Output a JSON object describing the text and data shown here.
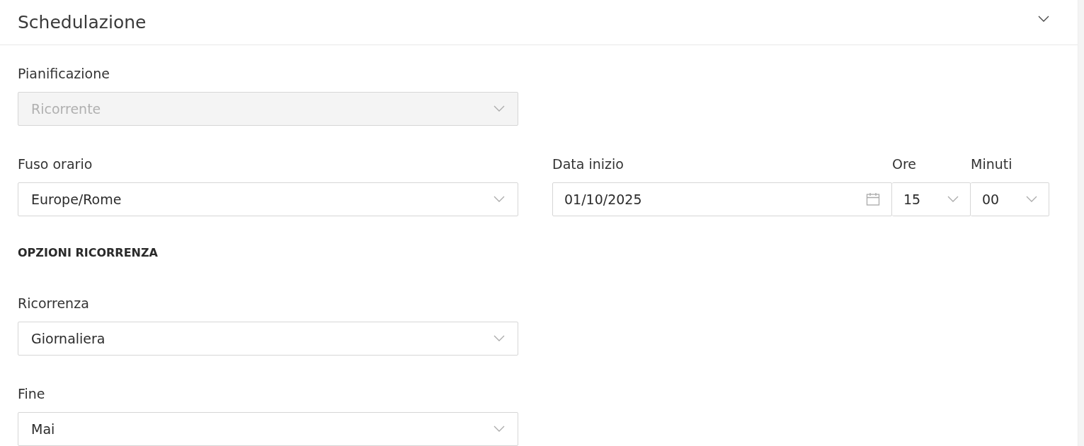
{
  "section": {
    "title": "Schedulazione",
    "expanded": true
  },
  "planning": {
    "label": "Pianificazione",
    "value": "Ricorrente",
    "disabled": true
  },
  "timezone": {
    "label": "Fuso orario",
    "value": "Europe/Rome",
    "disabled": false
  },
  "start_date": {
    "label": "Data inizio",
    "value": "01/10/2025"
  },
  "hours": {
    "label": "Ore",
    "value": "15"
  },
  "minutes": {
    "label": "Minuti",
    "value": "00"
  },
  "recurrence_options": {
    "heading": "OPZIONI RICORRENZA"
  },
  "recurrence": {
    "label": "Ricorrenza",
    "value": "Giornaliera",
    "disabled": false
  },
  "end": {
    "label": "Fine",
    "value": "Mai",
    "disabled": false
  }
}
